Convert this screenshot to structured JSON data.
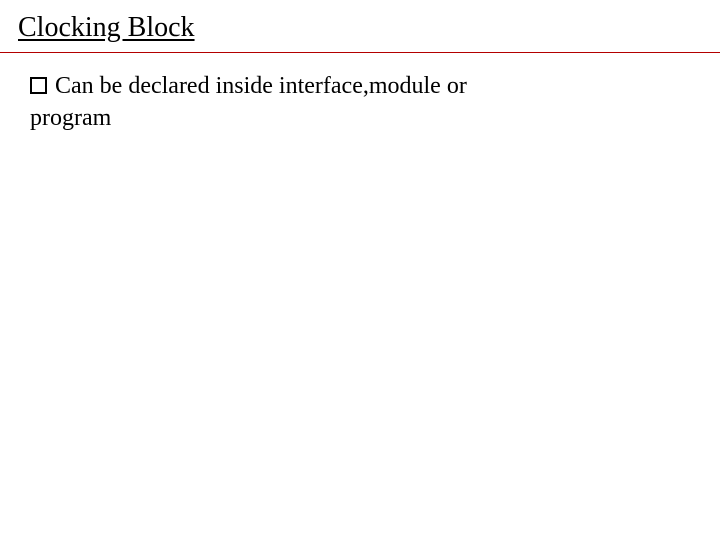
{
  "slide": {
    "title": "Clocking Block",
    "bullets": [
      {
        "line1": "Can be declared inside interface,module or",
        "line2": "program"
      }
    ]
  }
}
